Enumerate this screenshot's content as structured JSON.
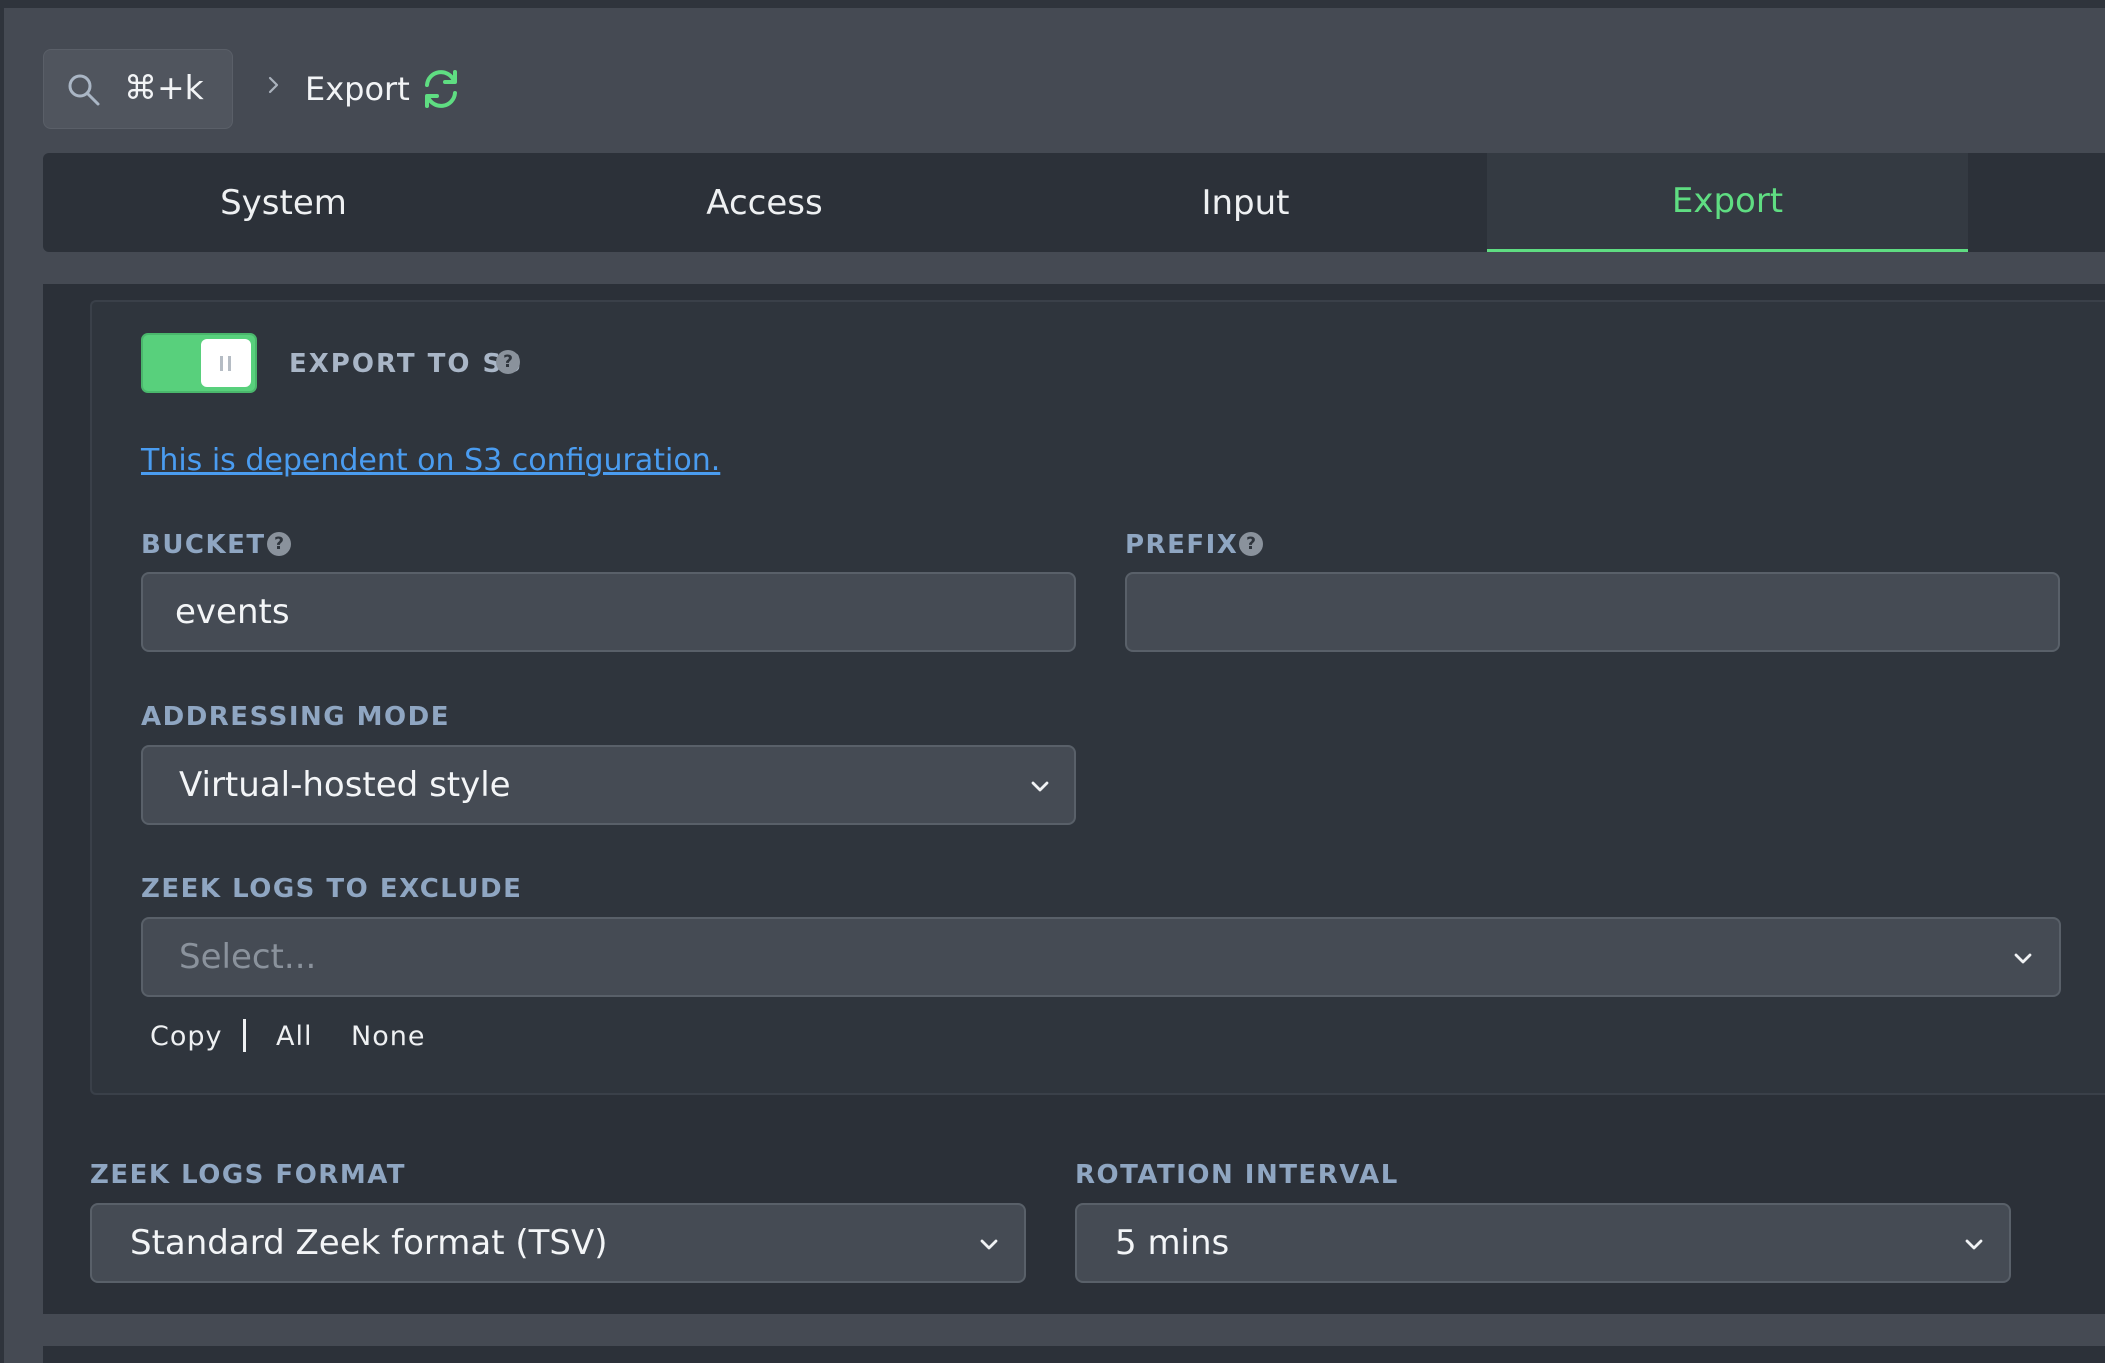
{
  "header": {
    "search_shortcut": "⌘+k",
    "breadcrumb": "Export"
  },
  "tabs": [
    {
      "label": "System",
      "active": false
    },
    {
      "label": "Access",
      "active": false
    },
    {
      "label": "Input",
      "active": false
    },
    {
      "label": "Export",
      "active": true
    }
  ],
  "export_s3": {
    "enabled": true,
    "title": "EXPORT TO S3",
    "dependency_link": "This is dependent on S3 configuration.",
    "bucket": {
      "label": "BUCKET",
      "value": "events"
    },
    "prefix": {
      "label": "PREFIX",
      "value": ""
    },
    "addressing_mode": {
      "label": "ADDRESSING MODE",
      "value": "Virtual-hosted style"
    },
    "zeek_logs_exclude": {
      "label": "ZEEK LOGS TO EXCLUDE",
      "placeholder": "Select...",
      "actions": {
        "copy": "Copy",
        "all": "All",
        "none": "None"
      }
    }
  },
  "zeek_logs_format": {
    "label": "ZEEK LOGS FORMAT",
    "value": "Standard Zeek format (TSV)"
  },
  "rotation_interval": {
    "label": "ROTATION INTERVAL",
    "value": "5 mins"
  },
  "colors": {
    "accent": "#5fdd82",
    "link": "#4a9cf0",
    "toggle_on": "#58d07c",
    "label": "#8fa6c2"
  },
  "icons": {
    "search": "search-icon",
    "breadcrumb_separator": "chevron-right-icon",
    "refresh": "refresh-icon",
    "help": "help-icon",
    "dropdown": "chevron-down-icon"
  }
}
